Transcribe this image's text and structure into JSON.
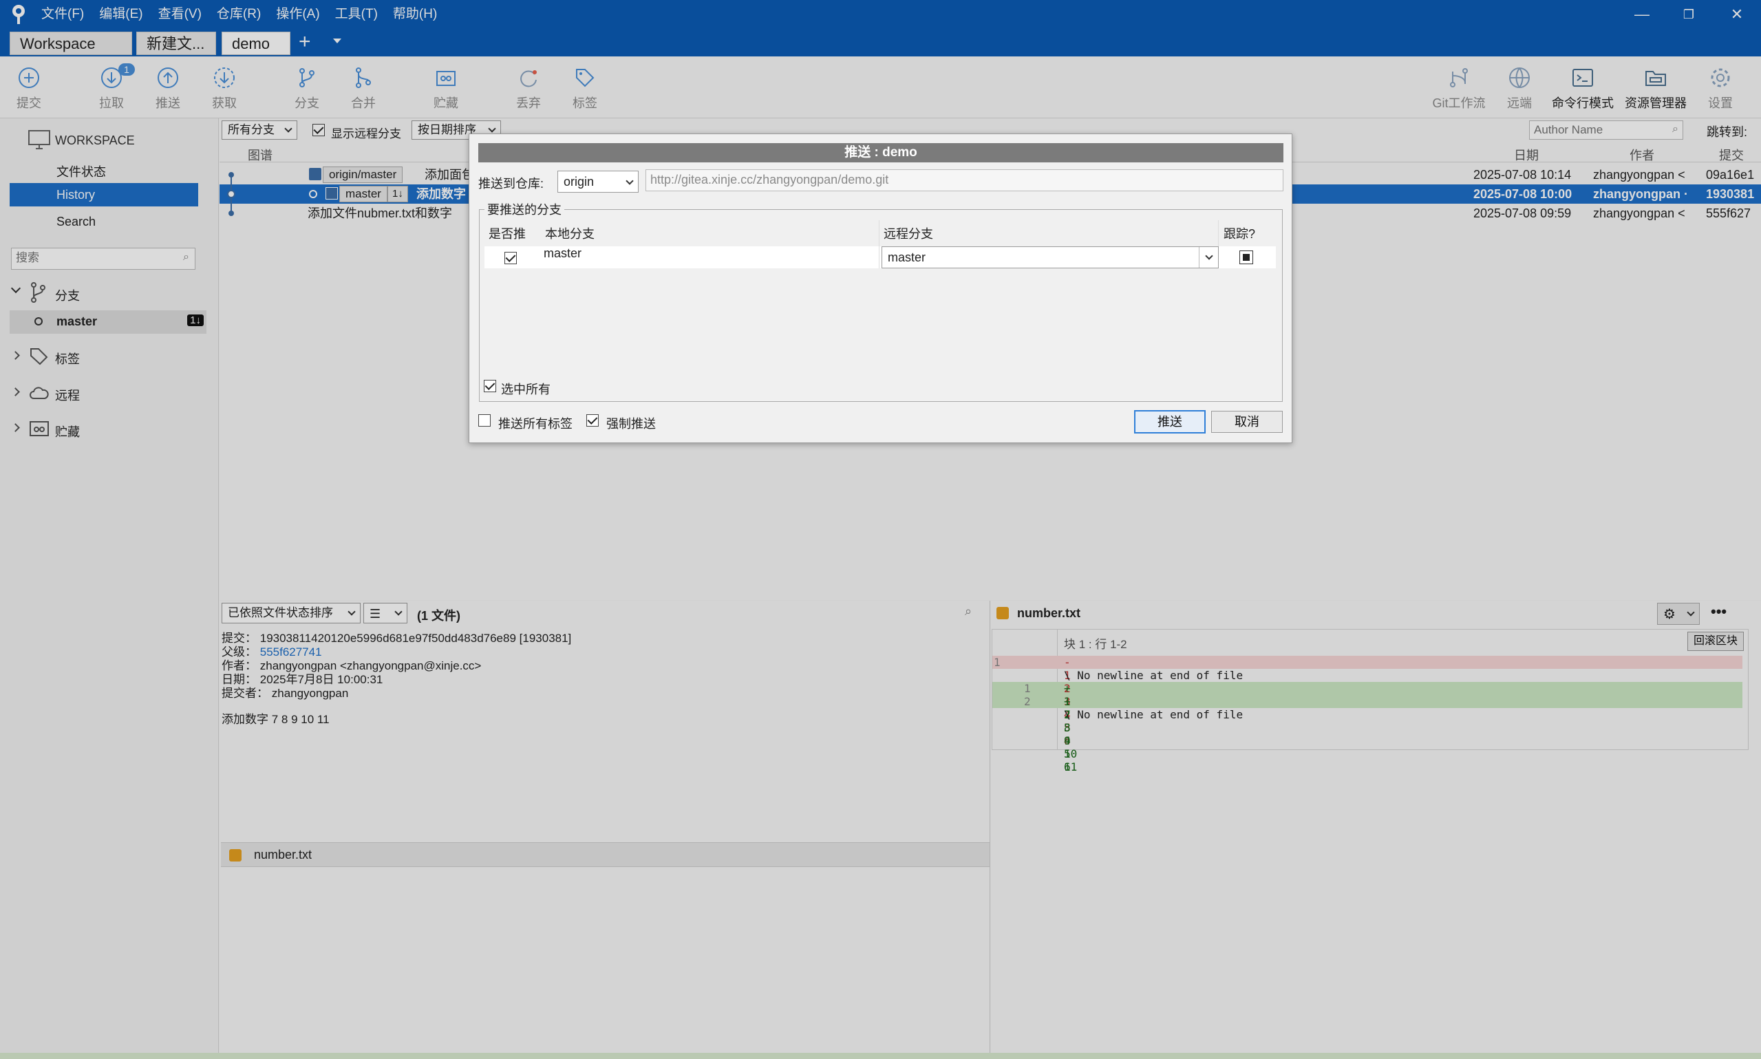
{
  "menu": [
    "文件(F)",
    "编辑(E)",
    "查看(V)",
    "仓库(R)",
    "操作(A)",
    "工具(T)",
    "帮助(H)"
  ],
  "tabs": [
    "Workspace",
    "新建文...",
    "demo"
  ],
  "window_controls": {
    "minimize": "—",
    "restore": "❐",
    "close": "✕"
  },
  "toolbar": {
    "commit": "提交",
    "pull": "拉取",
    "pull_badge": "1",
    "push": "推送",
    "fetch": "获取",
    "branch": "分支",
    "merge": "合并",
    "stash": "贮藏",
    "discard": "丢弃",
    "tag": "标签",
    "gitflow": "Git工作流",
    "remote": "远端",
    "terminal": "命令行模式",
    "explorer": "资源管理器",
    "settings": "设置"
  },
  "sidebar": {
    "workspace": "WORKSPACE",
    "file_status": "文件状态",
    "history": "History",
    "search": "Search",
    "search_placeholder": "搜索",
    "branches": "分支",
    "branch_master": "master",
    "branch_badge": "1↓",
    "tags": "标签",
    "remotes": "远程",
    "stashes": "贮藏"
  },
  "filters": {
    "all_branches": "所有分支",
    "show_remote": "显示远程分支",
    "sort_by_date": "按日期排序",
    "author_placeholder": "Author Name",
    "jump_to": "跳转到:"
  },
  "columns": {
    "graph": "图谱",
    "date": "日期",
    "author": "作者",
    "commit": "提交"
  },
  "commits": [
    {
      "ref": "origin/master",
      "desc": "添加面包",
      "date": "2025-07-08 10:14",
      "author": "zhangyongpan <",
      "hash": "09a16e1"
    },
    {
      "ref": "master",
      "ref_badge": "1↓",
      "desc": "添加数字",
      "date": "2025-07-08 10:00",
      "author": "zhangyongpan ·",
      "hash": "1930381"
    },
    {
      "ref": "",
      "desc": "添加文件nubmer.txt和数字",
      "date": "2025-07-08 09:59",
      "author": "zhangyongpan <",
      "hash": "555f627"
    }
  ],
  "details": {
    "sort_label": "已依照文件状态排序",
    "file_count": "(1 文件)",
    "commit_label": "提交：",
    "commit_value": "19303811420120e5996d681e97f50dd483d76e89 [1930381]",
    "parent_label": "父级：",
    "parent_value": "555f627741",
    "author_label": "作者：",
    "author_value": "zhangyongpan <zhangyongpan@xinje.cc>",
    "date_label": "日期：",
    "date_value": "2025年7月8日 10:00:31",
    "committer_label": "提交者：",
    "committer_value": "zhangyongpan",
    "message": "添加数字 7 8 9 10 11",
    "file_name": "number.txt"
  },
  "diff": {
    "file_name": "number.txt",
    "hunk_header": "块 1 : 行 1-2",
    "revert_button": "回滚区块",
    "lines": [
      {
        "old": "1",
        "new": "",
        "text": "- 1 2 3 4 5 6",
        "type": "del"
      },
      {
        "old": "",
        "new": "",
        "text": "\\ No newline at end of file",
        "type": "ctx"
      },
      {
        "old": "",
        "new": "1",
        "text": "+ 1 2 3 4 5 6",
        "type": "add"
      },
      {
        "old": "",
        "new": "2",
        "text": "+ 7 8 9 10 11",
        "type": "add"
      },
      {
        "old": "",
        "new": "",
        "text": "\\ No newline at end of file",
        "type": "ctx"
      }
    ]
  },
  "dialog": {
    "title": "推送 : demo",
    "push_to_repo_label": "推送到仓库:",
    "remote_selected": "origin",
    "remote_url": "http://gitea.xinje.cc/zhangyongpan/demo.git",
    "group_label": "要推送的分支",
    "col_push": "是否推",
    "col_local": "本地分支",
    "col_remote": "远程分支",
    "col_track": "跟踪?",
    "row_local": "master",
    "row_remote": "master",
    "select_all": "选中所有",
    "push_all_tags": "推送所有标签",
    "force_push": "强制推送",
    "push_button": "推送",
    "cancel_button": "取消"
  }
}
